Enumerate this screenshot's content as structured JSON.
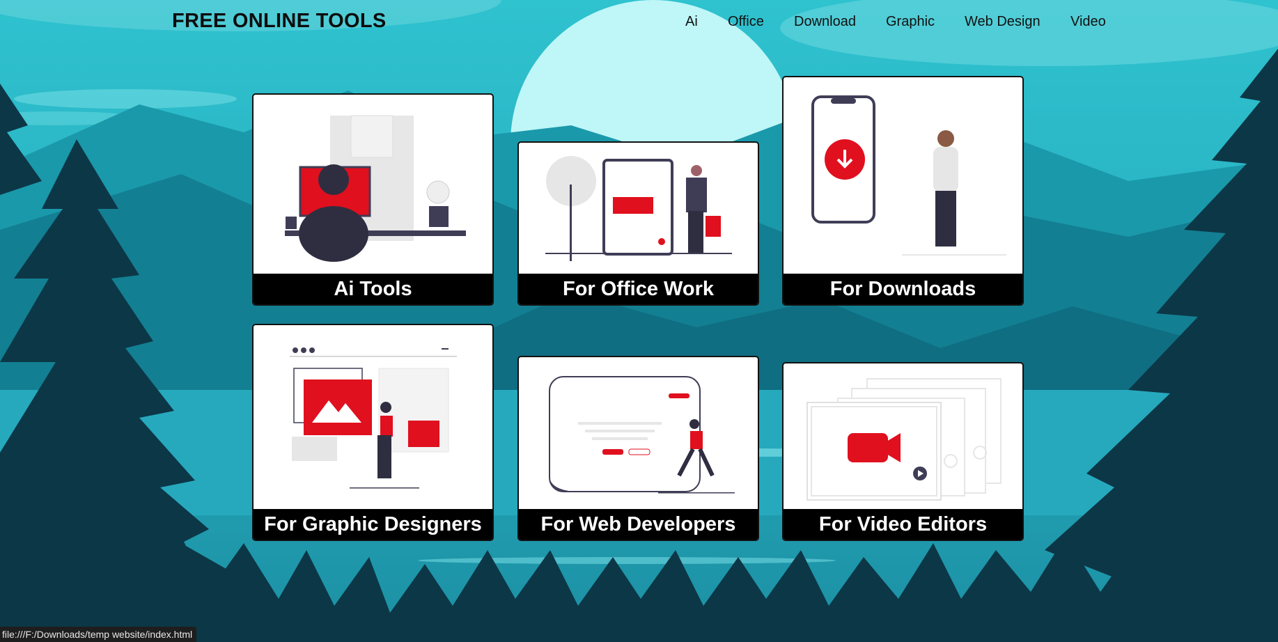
{
  "header": {
    "title": "FREE ONLINE TOOLS"
  },
  "nav": {
    "items": [
      "Ai",
      "Office",
      "Download",
      "Graphic",
      "Web Design",
      "Video"
    ]
  },
  "cards": [
    {
      "label": "Ai Tools"
    },
    {
      "label": "For Office Work"
    },
    {
      "label": "For Downloads"
    },
    {
      "label": "For Graphic Designers"
    },
    {
      "label": "For Web Developers"
    },
    {
      "label": "For Video Editors"
    }
  ],
  "status_bar": {
    "url": "file:///F:/Downloads/temp website/index.html"
  },
  "colors": {
    "accent": "#e0101e",
    "sky": "#2ab6c7",
    "dark": "#0f3d4c",
    "card_label_bg": "#000000"
  }
}
